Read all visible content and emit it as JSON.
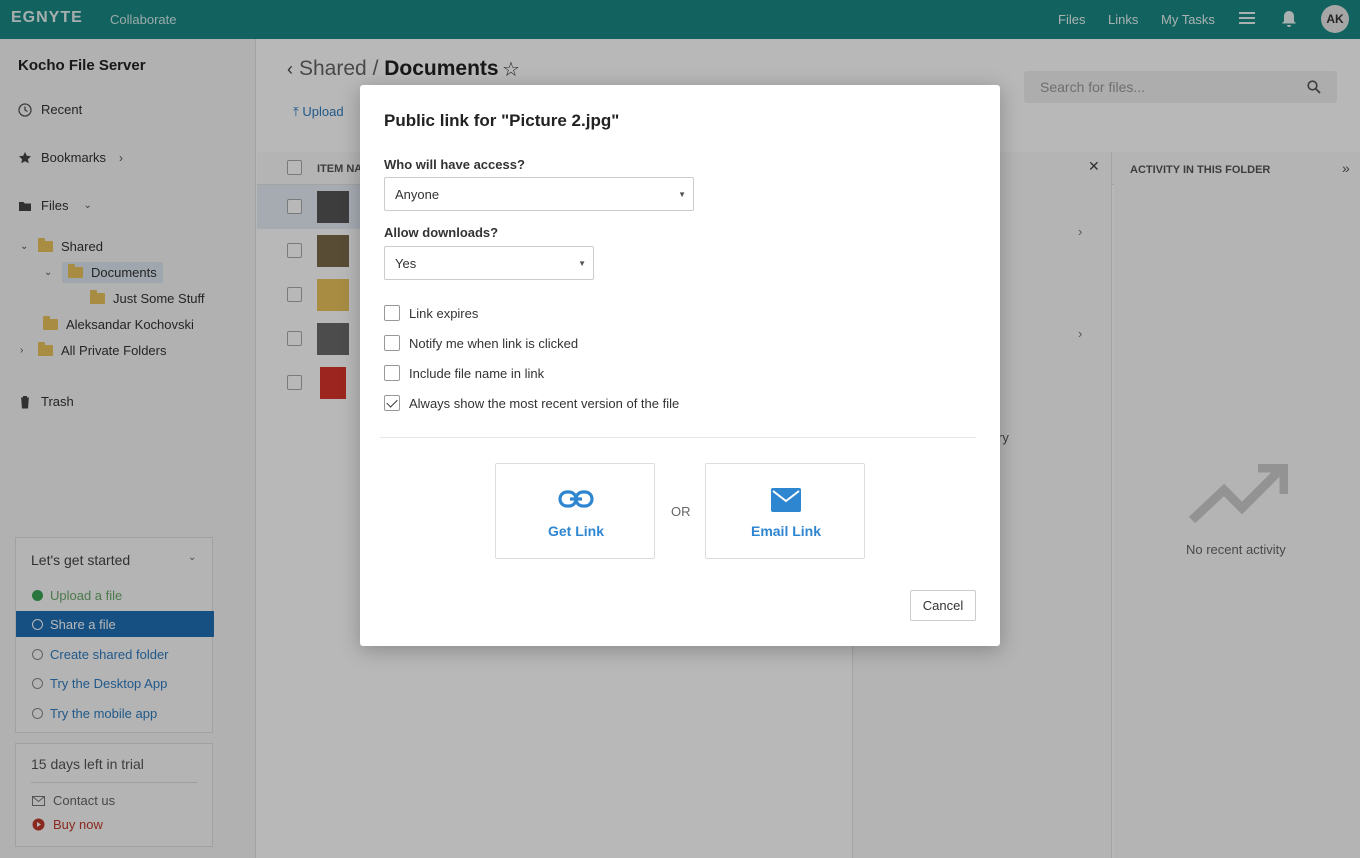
{
  "topbar": {
    "logo": "EGNYTE",
    "app": "Collaborate",
    "nav": [
      "Files",
      "Links",
      "My Tasks"
    ],
    "avatar": "AK"
  },
  "sidebar": {
    "server": "Kocho File Server",
    "recent": "Recent",
    "bookmarks": "Bookmarks",
    "files": "Files",
    "tree": {
      "shared": "Shared",
      "documents": "Documents",
      "just_some_stuff": "Just Some Stuff",
      "aleksandar": "Aleksandar Kochovski",
      "private": "All Private Folders"
    },
    "trash": "Trash"
  },
  "getting_started": {
    "title": "Let's get started",
    "items": [
      "Upload a file",
      "Share a file",
      "Create shared folder",
      "Try the Desktop App",
      "Try the mobile app"
    ]
  },
  "trial": {
    "title": "15 days left in trial",
    "contact": "Contact us",
    "buy": "Buy now"
  },
  "main": {
    "crumb_parent": "Shared",
    "crumb_sep": "/",
    "crumb_current": "Documents",
    "upload": "Upload",
    "search_placeholder": "Search for files...",
    "col_item_name": "ITEM NA",
    "activity_title": "ACTIVITY IN THIS FOLDER",
    "activity_empty": "No recent activity",
    "partial_text": "ry"
  },
  "modal": {
    "title": "Public link for \"Picture 2.jpg\"",
    "access_label": "Who will have access?",
    "access_value": "Anyone",
    "downloads_label": "Allow downloads?",
    "downloads_value": "Yes",
    "options": [
      {
        "label": "Link expires",
        "checked": false
      },
      {
        "label": "Notify me when link is clicked",
        "checked": false
      },
      {
        "label": "Include file name in link",
        "checked": false
      },
      {
        "label": "Always show the most recent version of the file",
        "checked": true
      }
    ],
    "get_link": "Get Link",
    "or": "OR",
    "email_link": "Email Link",
    "cancel": "Cancel"
  },
  "colors": {
    "topbar": "#1a8a85",
    "accent": "#2f86d0",
    "active_item": "#1f6fb6"
  }
}
